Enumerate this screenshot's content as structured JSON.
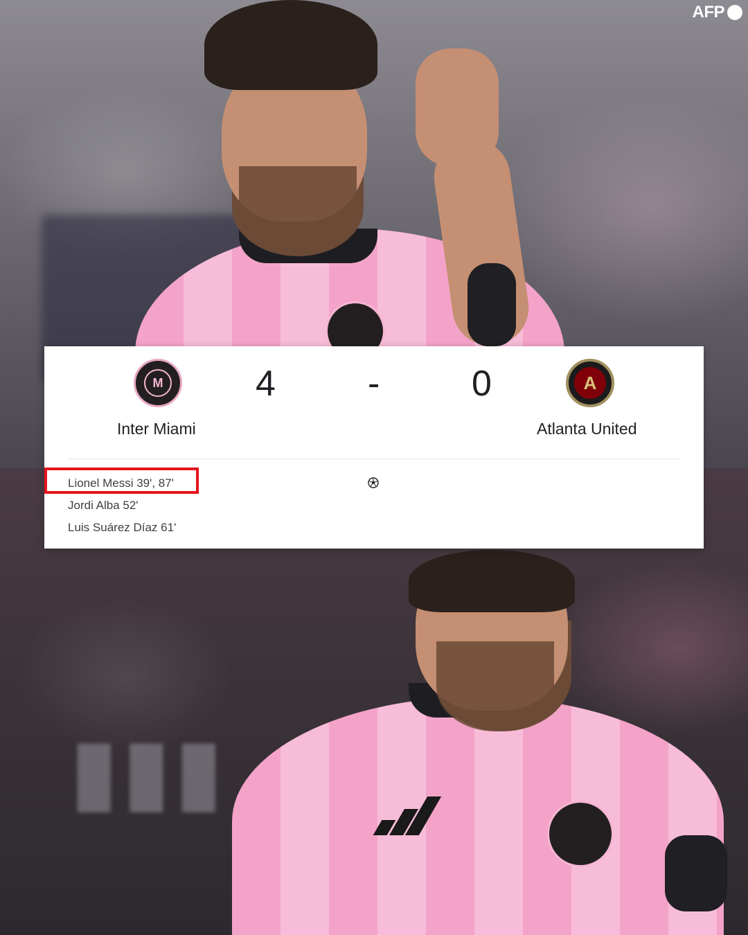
{
  "watermark": {
    "brand": "AFP",
    "icon": "afp-dot-icon"
  },
  "match": {
    "home": {
      "name": "Inter Miami",
      "score": "4",
      "logo_icon": "inter-miami-crest-icon",
      "logo_letter": "M"
    },
    "away": {
      "name": "Atlanta United",
      "score": "0",
      "logo_icon": "atlanta-united-crest-icon",
      "logo_letter": "A"
    },
    "separator": "-",
    "goal_icon": "soccer-ball-icon",
    "home_scorers": [
      "Lionel Messi 39', 87'",
      "Jordi Alba 52'",
      "Luis Suárez Díaz 61'"
    ],
    "highlight_color": "#e5141b"
  }
}
